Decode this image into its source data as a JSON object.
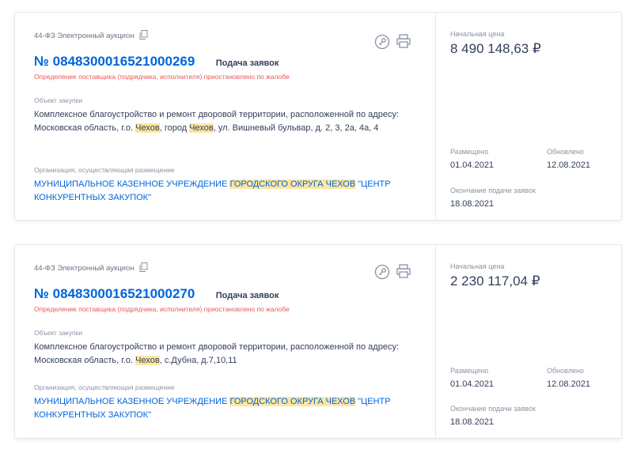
{
  "records": [
    {
      "procedure_type": "44-ФЗ Электронный аукцион",
      "number": "№ 0848300016521000269",
      "stage": "Подача заявок",
      "suspension_notice": "Определение поставщика (подрядчика, исполнителя) приостановлено по жалобе",
      "object_label": "Объект закупки",
      "object_parts": [
        "Комплексное благоустройство и ремонт дворовой территории, расположенной по адресу: Московская область, г.о. ",
        "Чехов",
        ", город ",
        "Чехов",
        ", ул. Вишневый бульвар, д. 2, 3, 2а, 4а, 4"
      ],
      "org_label": "Организация, осуществляющая размещение",
      "org_parts": [
        "МУНИЦИПАЛЬНОЕ КАЗЕННОЕ УЧРЕЖДЕНИЕ ",
        "ГОРОДСКОГО ОКРУГА ЧЕХОВ",
        " \"ЦЕНТР КОНКУРЕНТНЫХ ЗАКУПОК\""
      ],
      "price_label": "Начальная цена",
      "price": "8 490 148,63 ₽",
      "placed_label": "Размещено",
      "placed_date": "01.04.2021",
      "updated_label": "Обновлено",
      "updated_date": "12.08.2021",
      "deadline_label": "Окончание подачи заявок",
      "deadline_date": "18.08.2021"
    },
    {
      "procedure_type": "44-ФЗ Электронный аукцион",
      "number": "№ 0848300016521000270",
      "stage": "Подача заявок",
      "suspension_notice": "Определение поставщика (подрядчика, исполнителя) приостановлено по жалобе",
      "object_label": "Объект закупки",
      "object_parts": [
        "Комплексное благоустройство и ремонт дворовой территории, расположенной по адресу: Московская область, г.о. ",
        "Чехов",
        ", с.Дубна, д.7,10,11"
      ],
      "org_label": "Организация, осуществляющая размещение",
      "org_parts": [
        "МУНИЦИПАЛЬНОЕ КАЗЕННОЕ УЧРЕЖДЕНИЕ ",
        "ГОРОДСКОГО ОКРУГА ЧЕХОВ",
        " \"ЦЕНТР КОНКУРЕНТНЫХ ЗАКУПОК\""
      ],
      "price_label": "Начальная цена",
      "price": "2 230 117,04 ₽",
      "placed_label": "Размещено",
      "placed_date": "01.04.2021",
      "updated_label": "Обновлено",
      "updated_date": "12.08.2021",
      "deadline_label": "Окончание подачи заявок",
      "deadline_date": "18.08.2021"
    }
  ],
  "colors": {
    "link": "#0065dd",
    "alert": "#eb5757",
    "highlight": "#fee6a1"
  },
  "icons": [
    "copy-icon",
    "key-icon",
    "print-icon"
  ]
}
